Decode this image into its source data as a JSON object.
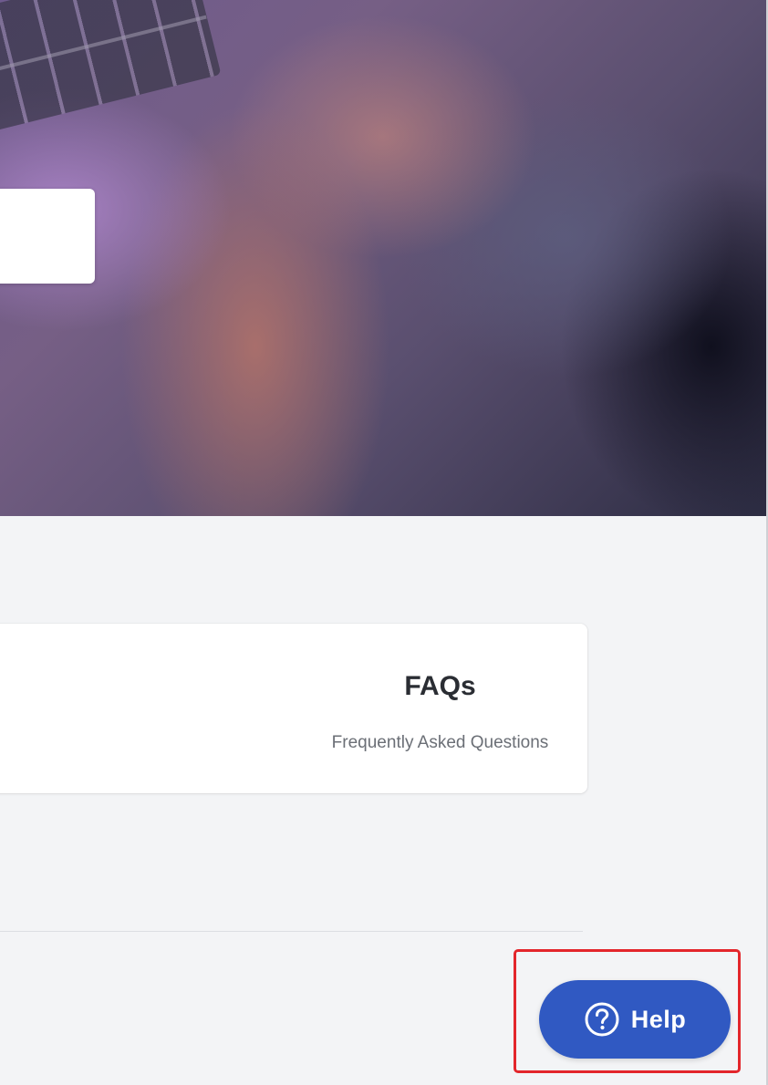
{
  "faq_card": {
    "title": "FAQs",
    "subtitle": "Frequently Asked Questions"
  },
  "help_button": {
    "label": "Help",
    "icon": "question-circle-icon",
    "background_color": "#3059c2",
    "highlight_color": "#e3262b"
  },
  "page": {
    "background_color": "#f3f4f6"
  }
}
